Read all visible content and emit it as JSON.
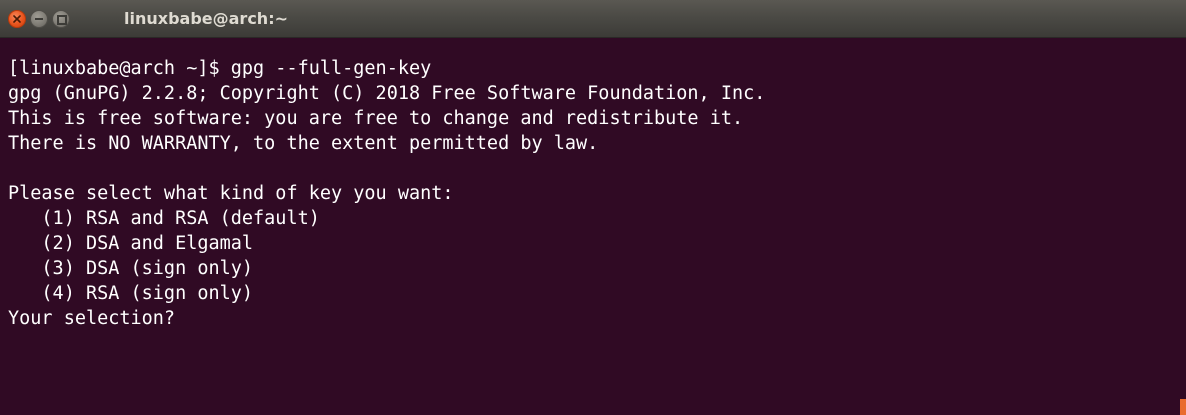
{
  "window": {
    "title": "linuxbabe@arch:~",
    "buttons": [
      "close",
      "minimize",
      "maximize"
    ]
  },
  "terminal": {
    "lines": [
      "[linuxbabe@arch ~]$ gpg --full-gen-key",
      "gpg (GnuPG) 2.2.8; Copyright (C) 2018 Free Software Foundation, Inc.",
      "This is free software: you are free to change and redistribute it.",
      "There is NO WARRANTY, to the extent permitted by law.",
      "",
      "Please select what kind of key you want:",
      "   (1) RSA and RSA (default)",
      "   (2) DSA and Elgamal",
      "   (3) DSA (sign only)",
      "   (4) RSA (sign only)",
      "Your selection?"
    ],
    "colors": {
      "background": "#300a24",
      "foreground": "#ffffff",
      "titlebar": "#3c3b37",
      "close_button": "#e9541d"
    }
  }
}
